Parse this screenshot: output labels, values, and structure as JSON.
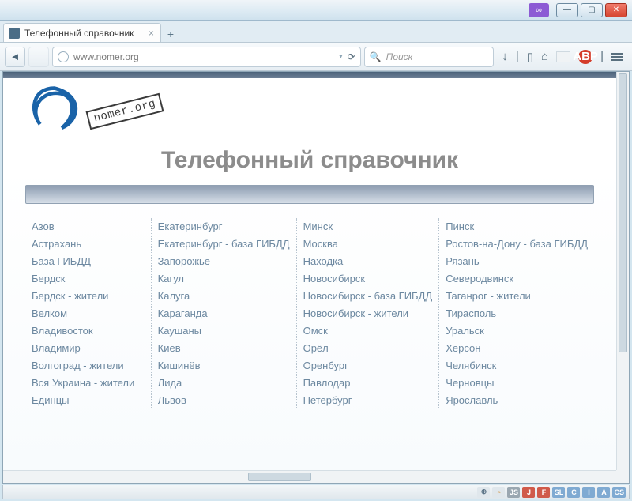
{
  "window": {
    "vpn_icon": "∞"
  },
  "tab": {
    "title": "Телефонный справочник",
    "close": "×",
    "newtab": "+"
  },
  "toolbar": {
    "back": "◄",
    "forward": "",
    "url": "www.nomer.org",
    "url_dd": "▾",
    "reload": "⟳",
    "search_icon": "🔍",
    "search_placeholder": "Поиск",
    "download": "↓",
    "home": "⌂",
    "bookmark": "▯",
    "abp": "ABP",
    "sep": "|"
  },
  "page": {
    "stamp": "nomer.org",
    "title": "Телефонный справочник"
  },
  "columns": [
    [
      "Азов",
      "Астрахань",
      "База ГИБДД",
      "Бердск",
      "Бердск - жители",
      "Велком",
      "Владивосток",
      "Владимир",
      "Волгоград - жители",
      "Вся Украина - жители",
      "Единцы"
    ],
    [
      "Екатеринбург",
      "Екатеринбург - база ГИБДД",
      "Запорожье",
      "Кагул",
      "Калуга",
      "Караганда",
      "Каушаны",
      "Киев",
      "Кишинёв",
      "Лида",
      "Львов"
    ],
    [
      "Минск",
      "Москва",
      "Находка",
      "Новосибирск",
      "Новосибирск - база ГИБДД",
      "Новосибирск - жители",
      "Омск",
      "Орёл",
      "Оренбург",
      "Павлодар",
      "Петербург"
    ],
    [
      "Пинск",
      "Ростов-на-Дону - база ГИБДД",
      "Рязань",
      "Северодвинск",
      "Таганрог - жители",
      "Тирасполь",
      "Уральск",
      "Херсон",
      "Челябинск",
      "Черновцы",
      "Ярославль"
    ]
  ],
  "statusbar": {
    "badges": [
      {
        "t": "⊕",
        "bg": "#e0e7ec",
        "fg": "#5b7386"
      },
      {
        "t": "◔",
        "bg": "#e0e7ec",
        "fg": "#d08a2a"
      },
      {
        "t": "JS",
        "bg": "#9aa7b1"
      },
      {
        "t": "J",
        "bg": "#d05a4a"
      },
      {
        "t": "F",
        "bg": "#d05a4a"
      },
      {
        "t": "SL",
        "bg": "#7faad2"
      },
      {
        "t": "C",
        "bg": "#7faad2"
      },
      {
        "t": "I",
        "bg": "#7faad2"
      },
      {
        "t": "A",
        "bg": "#7faad2"
      },
      {
        "t": "CS",
        "bg": "#7faad2"
      }
    ]
  }
}
